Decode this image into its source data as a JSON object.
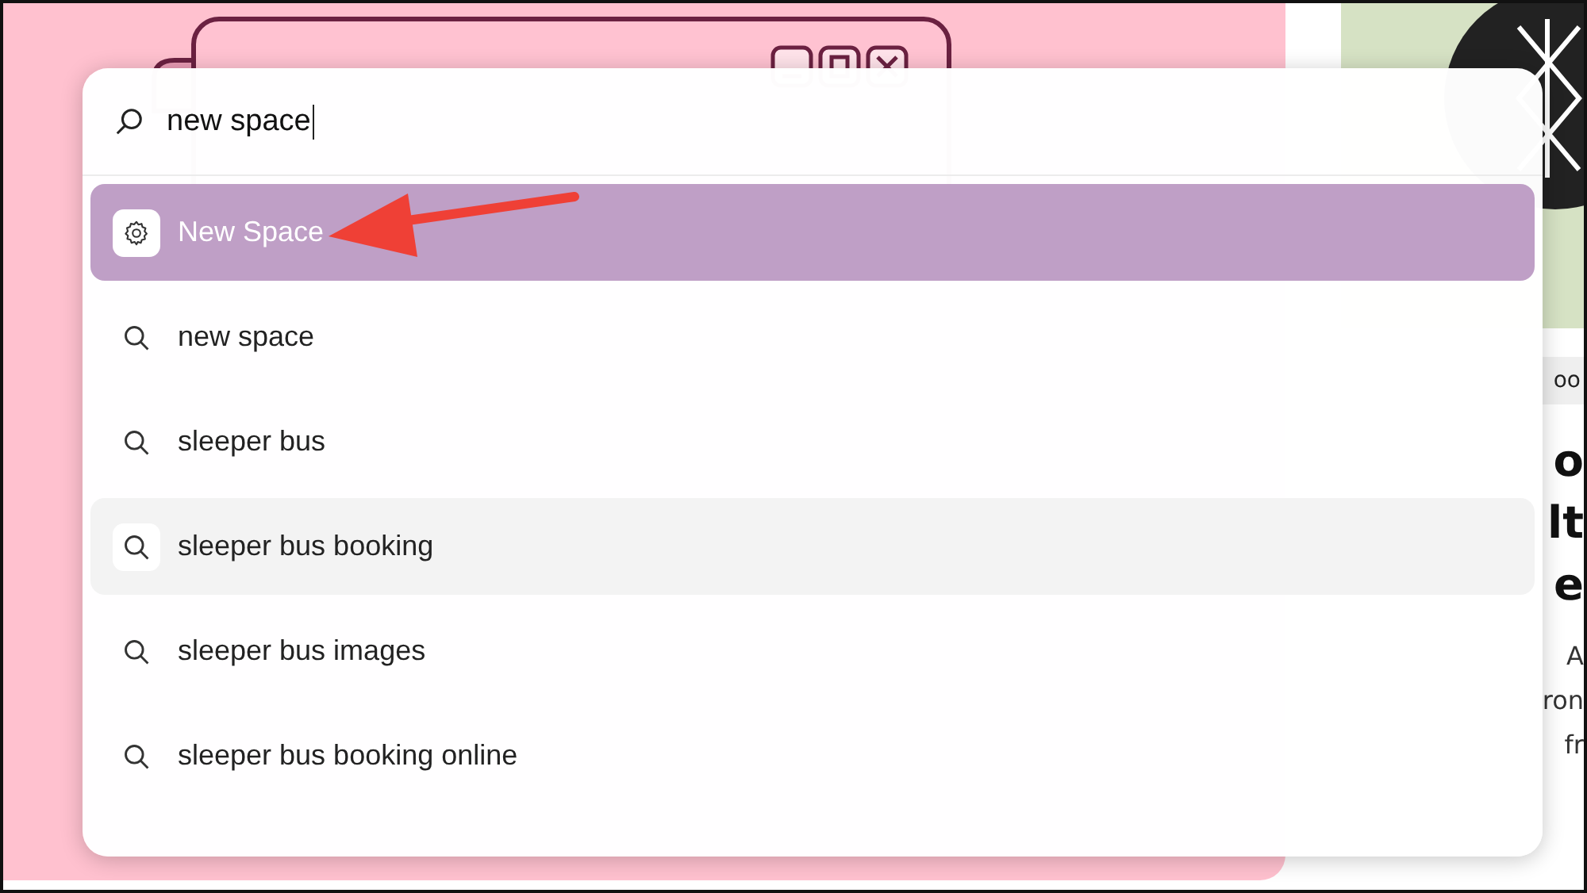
{
  "search": {
    "value": "new space"
  },
  "results": [
    {
      "kind": "action",
      "label": "New Space",
      "selected": true,
      "hovered": false
    },
    {
      "kind": "search",
      "label": "new space",
      "selected": false,
      "hovered": false
    },
    {
      "kind": "search",
      "label": "sleeper bus",
      "selected": false,
      "hovered": false
    },
    {
      "kind": "search",
      "label": "sleeper bus booking",
      "selected": false,
      "hovered": true
    },
    {
      "kind": "search",
      "label": "sleeper bus images",
      "selected": false,
      "hovered": false
    },
    {
      "kind": "search",
      "label": "sleeper bus booking online",
      "selected": false,
      "hovered": false
    }
  ],
  "background_article": {
    "tab": "oo",
    "headline": [
      "o",
      "lt",
      "e"
    ],
    "summary": [
      "A",
      "ron",
      "fr"
    ]
  }
}
